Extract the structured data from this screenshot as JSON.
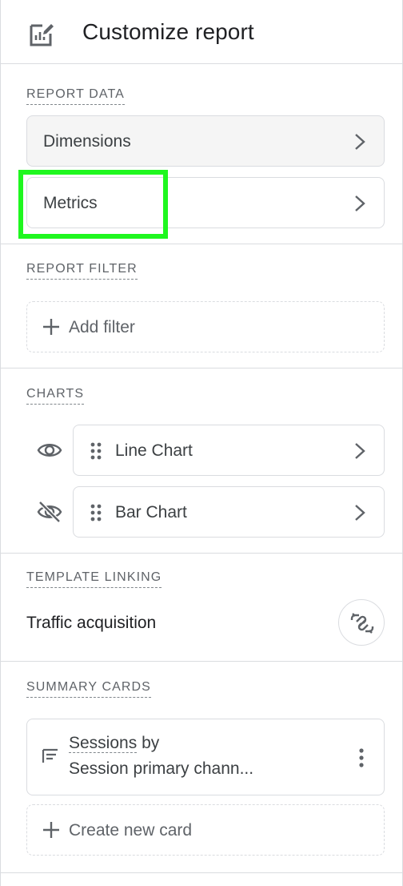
{
  "header": {
    "title": "Customize report",
    "icon": "edit-report-icon"
  },
  "report_data": {
    "label": "REPORT DATA",
    "items": [
      {
        "label": "Dimensions"
      },
      {
        "label": "Metrics"
      }
    ]
  },
  "report_filter": {
    "label": "REPORT FILTER",
    "add_label": "Add filter"
  },
  "charts": {
    "label": "CHARTS",
    "items": [
      {
        "label": "Line Chart",
        "visible": true
      },
      {
        "label": "Bar Chart",
        "visible": false
      }
    ]
  },
  "template_linking": {
    "label": "TEMPLATE LINKING",
    "template": "Traffic acquisition"
  },
  "summary_cards": {
    "label": "SUMMARY CARDS",
    "card": {
      "metric": "Sessions",
      "connector": "by",
      "dimension": "Session primary chann..."
    },
    "create_label": "Create new card"
  },
  "colors": {
    "highlight": "#1ff71f",
    "border": "#dadce0",
    "text": "#3c4043",
    "muted": "#5f6368"
  }
}
